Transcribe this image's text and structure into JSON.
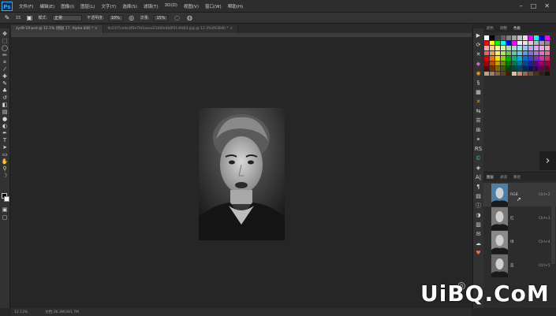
{
  "app": {
    "logo": "Ps",
    "menus": [
      "文件(F)",
      "编辑(E)",
      "图像(I)",
      "图层(L)",
      "文字(Y)",
      "选择(S)",
      "滤镜(T)",
      "3D(D)",
      "视图(V)",
      "窗口(W)",
      "帮助(H)"
    ],
    "window_controls": [
      "–",
      "□",
      "✕"
    ]
  },
  "options_bar": {
    "size": "15",
    "mode_label": "模式:",
    "mode_value": "正常",
    "opacity_label": "不透明度:",
    "opacity_value": "10%",
    "flow_label": "流量:",
    "flow_value": "15%"
  },
  "tabs": [
    {
      "label": "zyd9-19.psd @ 12.1% (图层 17, Alpha 4/8) * ×",
      "active": true
    },
    {
      "label": "9c01f7cede3f0e7fa5aoca21b6fe4b0f1f.4fd03.jpg @ 12.4%(RGB/8) * ×",
      "active": false
    }
  ],
  "status": {
    "zoom": "12.13%",
    "doc": "文档:26.3M/391.7M"
  },
  "swatch_panel": {
    "tabs": [
      "颜色",
      "调整",
      "色板"
    ],
    "active_tab": "色板",
    "colors": [
      "#ffffff",
      "#000000",
      "#404040",
      "#606060",
      "#808080",
      "#a0a0a0",
      "#c0c0c0",
      "#e0e0e0",
      "#ff00ff",
      "#00ffff",
      "#0000ff",
      "#ff00ff",
      "#ff0000",
      "#ffff00",
      "#00ff00",
      "#00ffff",
      "#0000ff",
      "#ff00ff",
      "#ffffff",
      "#e6e6e6",
      "#d0d0d0",
      "#b8b8b8",
      "#a0a0a0",
      "#888888",
      "#f7a8a8",
      "#f9c9a0",
      "#fff3a0",
      "#d8f0a0",
      "#a8e0a0",
      "#a0e0c8",
      "#a0e0f0",
      "#a0c0f0",
      "#b0a8f0",
      "#d0a8f0",
      "#f0a8e0",
      "#f0a8c0",
      "#f06060",
      "#f59a50",
      "#fff060",
      "#b8e060",
      "#60c860",
      "#60c8a0",
      "#60c8e8",
      "#6098e8",
      "#8070e0",
      "#b070e0",
      "#e070c8",
      "#e07098",
      "#e00000",
      "#f07000",
      "#ffe000",
      "#90d000",
      "#00b000",
      "#00b080",
      "#00b0e0",
      "#0070d0",
      "#4040c0",
      "#8030c0",
      "#d030a0",
      "#d03060",
      "#a00000",
      "#b05000",
      "#c0a000",
      "#609000",
      "#007800",
      "#007858",
      "#0078a0",
      "#004898",
      "#202090",
      "#580090",
      "#980070",
      "#980040",
      "#600000",
      "#703000",
      "#806800",
      "#405800",
      "#004800",
      "#004838",
      "#004868",
      "#002860",
      "#101058",
      "#380058",
      "#600048",
      "#600028",
      "#c0a080",
      "#a08060",
      "#806040",
      "#604020",
      "#402000",
      "#e0c0a0",
      "#c09070",
      "#907050",
      "#705030",
      "#503010",
      "#302010",
      "#181008"
    ]
  },
  "layers_panel": {
    "tabs": [
      "图层",
      "通道",
      "路径"
    ],
    "active_tab": "图层",
    "rows": [
      {
        "name": "RGB",
        "shortcut": "Ctrl+2"
      },
      {
        "name": "红",
        "shortcut": "Ctrl+3"
      },
      {
        "name": "绿",
        "shortcut": "Ctrl+4"
      },
      {
        "name": "蓝",
        "shortcut": "Ctrl+5"
      }
    ]
  },
  "watermark": {
    "text": "UiBQ.CoM"
  }
}
